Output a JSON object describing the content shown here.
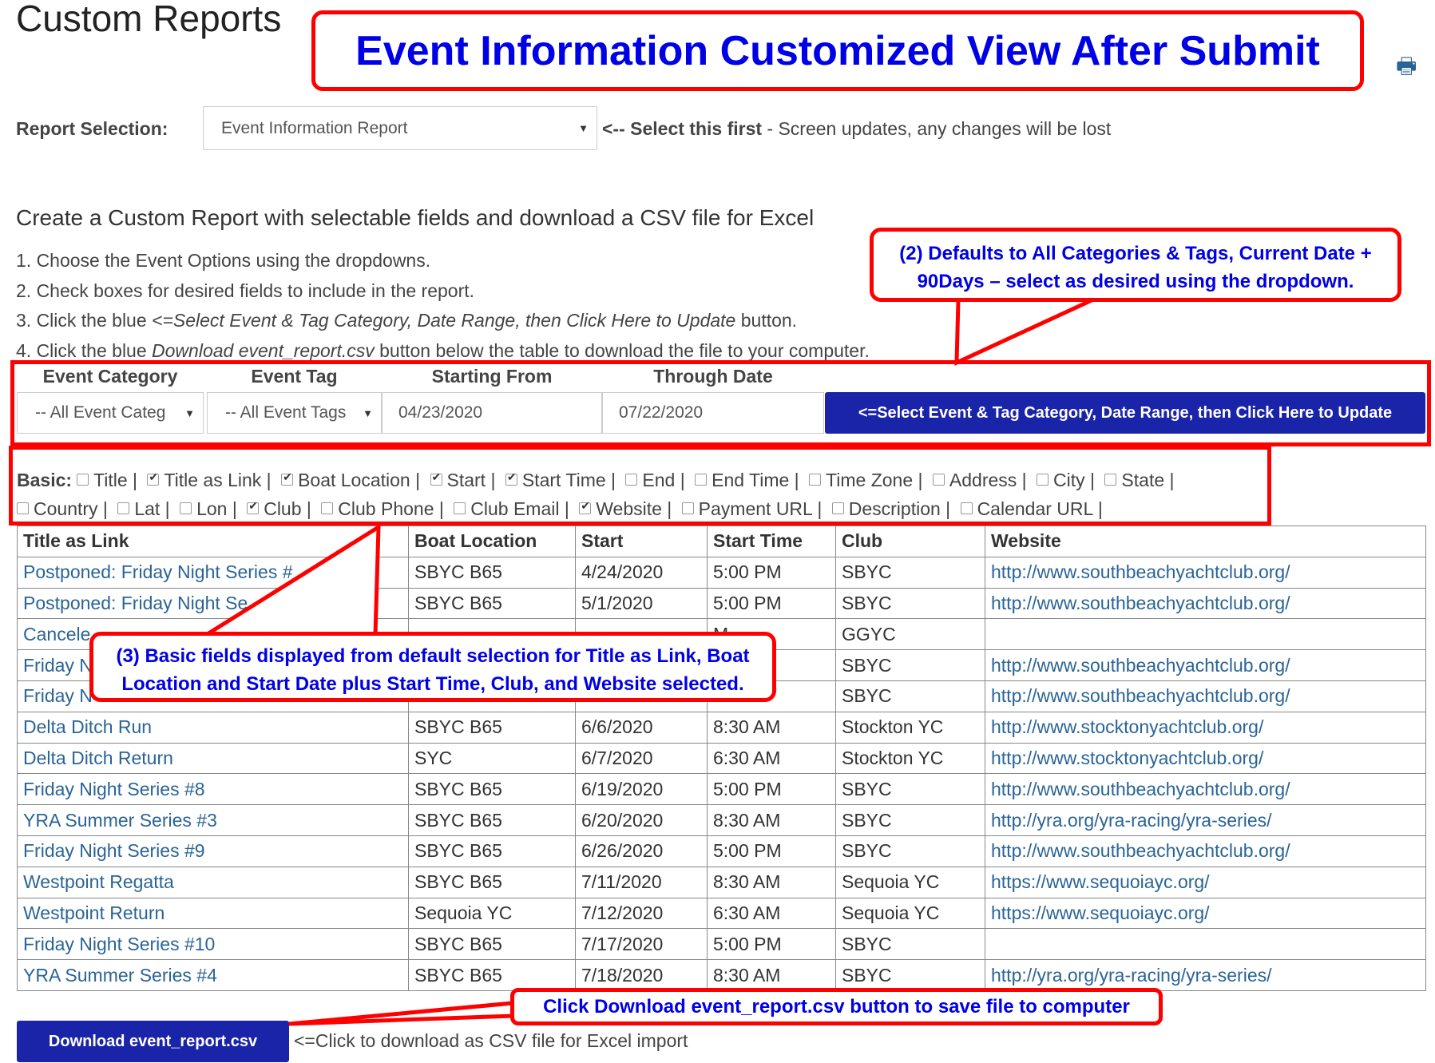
{
  "page": {
    "title": "Custom Reports",
    "print_icon": "printer-icon"
  },
  "annotations": {
    "banner": "Event Information Customized View After Submit",
    "note2": "(2) Defaults to All Categories & Tags, Current Date + 90Days – select as desired using the dropdown.",
    "note3": "(3) Basic fields displayed from default selection for Title as Link, Boat Location and Start Date plus Start Time, Club, and Website selected.",
    "note4": "Click Download event_report.csv button to save file to computer",
    "color": "#ff0000",
    "text_color": "#0000e6"
  },
  "report_selection": {
    "label": "Report Selection:",
    "value": "Event Information Report",
    "hint_bold": "<-- Select this first",
    "hint": " - Screen updates, any changes will be lost"
  },
  "heading": "Create a Custom Report with selectable fields and download a CSV file for Excel",
  "instructions": {
    "l1": "1. Choose the Event Options using the dropdowns.",
    "l2": "2. Check boxes for desired fields to include in the report.",
    "l3a": "3. Click the blue ",
    "l3b": "<=Select Event & Tag Category, Date Range, then Click Here to Update",
    "l3c": " button.",
    "l4a": "4. Click the blue ",
    "l4b": "Download event_report.csv",
    "l4c": " button below the table to download the file to your computer."
  },
  "filters": {
    "category_label": "Event Category",
    "category_value": "-- All Event Categ",
    "tag_label": "Event Tag",
    "tag_value": "-- All Event Tags",
    "start_label": "Starting From",
    "start_value": "04/23/2020",
    "through_label": "Through Date",
    "through_value": "07/22/2020",
    "update_button": "<=Select Event & Tag Category, Date Range, then Click Here to Update",
    "button_color": "#1a24a8"
  },
  "fields": {
    "basic_label": "Basic:",
    "items": [
      {
        "label": "Title",
        "checked": false
      },
      {
        "label": "Title as Link",
        "checked": true
      },
      {
        "label": "Boat Location",
        "checked": true
      },
      {
        "label": "Start",
        "checked": true
      },
      {
        "label": "Start Time",
        "checked": true
      },
      {
        "label": "End",
        "checked": false
      },
      {
        "label": "End Time",
        "checked": false
      },
      {
        "label": "Time Zone",
        "checked": false
      },
      {
        "label": "Address",
        "checked": false
      },
      {
        "label": "City",
        "checked": false
      },
      {
        "label": "State",
        "checked": false
      },
      {
        "label": "Country",
        "checked": false
      },
      {
        "label": "Lat",
        "checked": false
      },
      {
        "label": "Lon",
        "checked": false
      },
      {
        "label": "Club",
        "checked": true
      },
      {
        "label": "Club Phone",
        "checked": false
      },
      {
        "label": "Club Email",
        "checked": false
      },
      {
        "label": "Website",
        "checked": true
      },
      {
        "label": "Payment URL",
        "checked": false
      },
      {
        "label": "Description",
        "checked": false
      },
      {
        "label": "Calendar URL",
        "checked": false
      }
    ]
  },
  "table": {
    "columns": [
      "Title as Link",
      "Boat Location",
      "Start",
      "Start Time",
      "Club",
      "Website"
    ],
    "rows": [
      [
        "Postponed: Friday Night Series #",
        "SBYC B65",
        "4/24/2020",
        "5:00 PM",
        "SBYC",
        "http://www.southbeachyachtclub.org/"
      ],
      [
        "Postponed: Friday Night Se",
        "SBYC B65",
        "5/1/2020",
        "5:00 PM",
        "SBYC",
        "http://www.southbeachyachtclub.org/"
      ],
      [
        "Cancele",
        "",
        "",
        "M",
        "GGYC",
        ""
      ],
      [
        "Friday N",
        "",
        "",
        "M",
        "SBYC",
        "http://www.southbeachyachtclub.org/"
      ],
      [
        "Friday N",
        "",
        "",
        "M",
        "SBYC",
        "http://www.southbeachyachtclub.org/"
      ],
      [
        "Delta Ditch Run",
        "SBYC B65",
        "6/6/2020",
        "8:30 AM",
        "Stockton YC",
        "http://www.stocktonyachtclub.org/"
      ],
      [
        "Delta Ditch Return",
        "SYC",
        "6/7/2020",
        "6:30 AM",
        "Stockton YC",
        "http://www.stocktonyachtclub.org/"
      ],
      [
        "Friday Night Series #8",
        "SBYC B65",
        "6/19/2020",
        "5:00 PM",
        "SBYC",
        "http://www.southbeachyachtclub.org/"
      ],
      [
        "YRA Summer Series #3",
        "SBYC B65",
        "6/20/2020",
        "8:30 AM",
        "SBYC",
        "http://yra.org/yra-racing/yra-series/"
      ],
      [
        "Friday Night Series #9",
        "SBYC B65",
        "6/26/2020",
        "5:00 PM",
        "SBYC",
        "http://www.southbeachyachtclub.org/"
      ],
      [
        "Westpoint Regatta",
        "SBYC B65",
        "7/11/2020",
        "8:30 AM",
        "Sequoia YC",
        "https://www.sequoiayc.org/"
      ],
      [
        "Westpoint Return",
        "Sequoia YC",
        "7/12/2020",
        "6:30 AM",
        "Sequoia YC",
        "https://www.sequoiayc.org/"
      ],
      [
        "Friday Night Series #10",
        "SBYC B65",
        "7/17/2020",
        "5:00 PM",
        "SBYC",
        ""
      ],
      [
        "YRA Summer Series #4",
        "SBYC B65",
        "7/18/2020",
        "8:30 AM",
        "SBYC",
        "http://yra.org/yra-racing/yra-series/"
      ]
    ]
  },
  "download": {
    "button": "Download event_report.csv",
    "hint": "<=Click to download as CSV file for Excel import"
  }
}
